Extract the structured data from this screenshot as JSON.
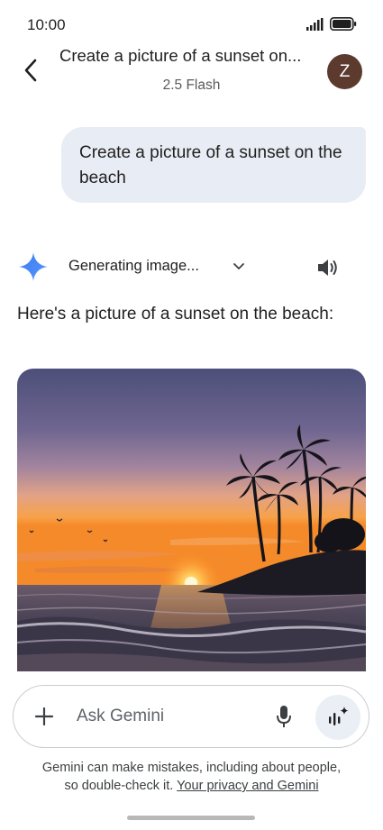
{
  "status_bar": {
    "time": "10:00"
  },
  "header": {
    "title": "Create a picture of a sunset on...",
    "subtitle": "2.5 Flash",
    "avatar_letter": "Z"
  },
  "conversation": {
    "user_message": "Create a picture of a sunset on the beach",
    "response": {
      "status": "Generating image...",
      "text": "Here's a picture of a sunset on the beach:"
    }
  },
  "input_bar": {
    "placeholder": "Ask Gemini"
  },
  "disclaimer": {
    "line1": "Gemini can make mistakes, including about people,",
    "line2": "so double-check it.",
    "link": "Your privacy and Gemini"
  },
  "colors": {
    "avatar_bg": "#5d3a2e",
    "user_bubble_bg": "#e8ecf4",
    "gemini_blue": "#4285f4"
  },
  "icons": [
    "back-arrow-icon",
    "gemini-sparkle-icon",
    "chevron-down-icon",
    "speaker-icon",
    "plus-icon",
    "microphone-icon",
    "live-sparkle-icon",
    "signal-icon",
    "battery-icon"
  ]
}
